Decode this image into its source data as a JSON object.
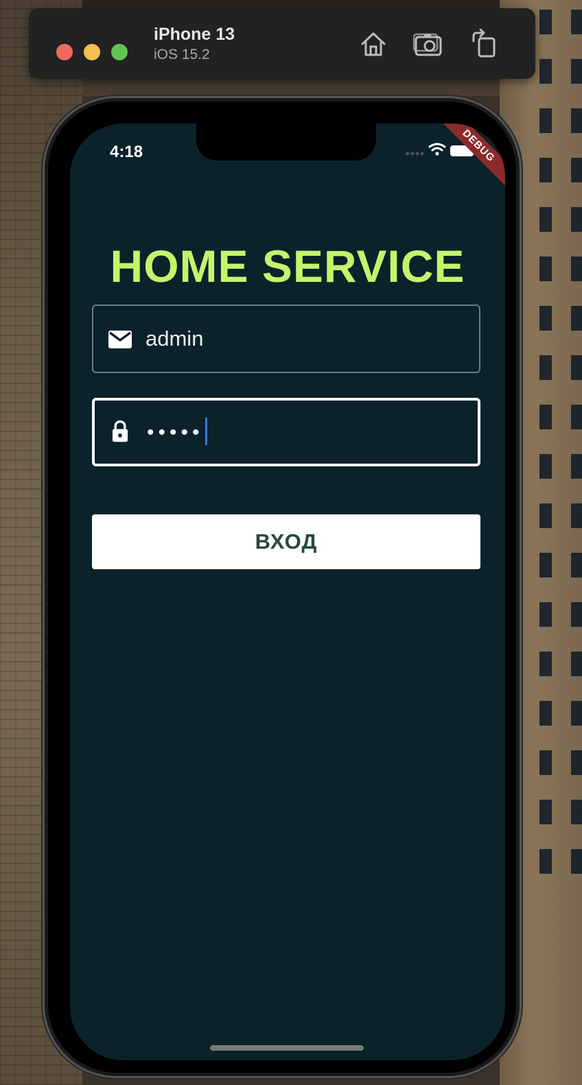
{
  "simulator": {
    "device_name": "iPhone 13",
    "os_version": "iOS 15.2"
  },
  "status_bar": {
    "time": "4:18"
  },
  "debug_banner": "DEBUG",
  "app": {
    "title": "HOME SERVICE",
    "email_value": "admin",
    "password_value": "•••••",
    "login_label": "ВХОД"
  },
  "colors": {
    "screen_background": "#0b222b",
    "title_color": "#c3f56b",
    "button_text": "#2a4a35",
    "caret": "#3a7bd5"
  }
}
